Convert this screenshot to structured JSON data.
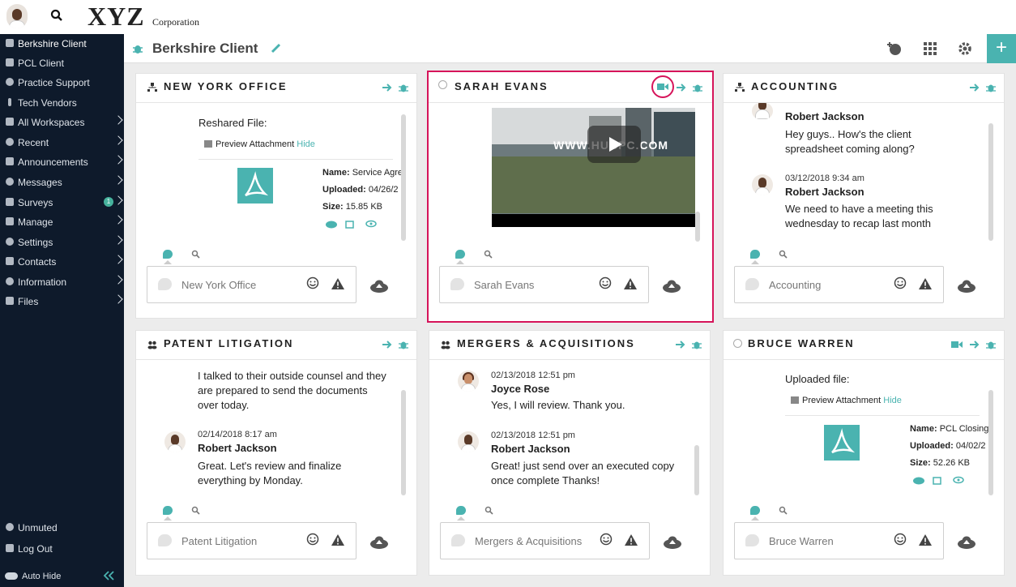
{
  "topbar": {
    "logo": "XYZ",
    "logo_sub": "Corporation"
  },
  "sidebar": {
    "items": [
      {
        "label": "Berkshire Client",
        "icon": "bug-icon"
      },
      {
        "label": "PCL Client",
        "icon": "bug-icon"
      },
      {
        "label": "Practice Support",
        "icon": "globe-icon"
      },
      {
        "label": "Tech Vendors",
        "icon": "pin-icon"
      },
      {
        "label": "All Workspaces",
        "icon": "grid-icon"
      },
      {
        "label": "Recent",
        "icon": "clock-icon"
      },
      {
        "label": "Announcements",
        "icon": "megaphone-icon"
      },
      {
        "label": "Messages",
        "icon": "chat-icon"
      },
      {
        "label": "Surveys",
        "icon": "clipboard-icon",
        "badge": "1"
      },
      {
        "label": "Manage",
        "icon": "pencil-icon"
      },
      {
        "label": "Settings",
        "icon": "gear-icon"
      },
      {
        "label": "Contacts",
        "icon": "contact-icon"
      },
      {
        "label": "Information",
        "icon": "question-icon"
      },
      {
        "label": "Files",
        "icon": "folder-icon"
      }
    ],
    "unmuted": "Unmuted",
    "logout": "Log Out",
    "autohide": "Auto Hide"
  },
  "header": {
    "title": "Berkshire Client",
    "plus": "+"
  },
  "panels": {
    "ny": {
      "title": "NEW YORK OFFICE",
      "attach_label": "Reshared File:",
      "preview": "Preview Attachment",
      "hide": "Hide",
      "name_k": "Name:",
      "name_v": "Service Agre",
      "uploaded_k": "Uploaded:",
      "uploaded_v": "04/26/2",
      "size_k": "Size:",
      "size_v": "15.85 KB",
      "placeholder": "New York Office"
    },
    "sarah": {
      "title": "SARAH EVANS",
      "video_text": "WWW.HUBPC.COM",
      "placeholder": "Sarah Evans"
    },
    "acct": {
      "title": "ACCOUNTING",
      "m1_name": "Robert Jackson",
      "m1_text": "Hey guys.. How's the client spreadsheet coming along?",
      "m2_time": "03/12/2018 9:34 am",
      "m2_name": "Robert Jackson",
      "m2_text": "We need to have a meeting this wednesday to recap last month",
      "placeholder": "Accounting"
    },
    "patent": {
      "title": "PATENT LITIGATION",
      "m1_text": "I talked to their outside counsel and they are prepared to send the documents over today.",
      "m2_time": "02/14/2018 8:17 am",
      "m2_name": "Robert Jackson",
      "m2_text": "Great.  Let's review and finalize everything by Monday.",
      "placeholder": "Patent Litigation"
    },
    "mergers": {
      "title": "MERGERS & ACQUISITIONS",
      "m1_time": "02/13/2018 12:51 pm",
      "m1_name": "Joyce Rose",
      "m1_text": "Yes, I will review.  Thank you.",
      "m2_time": "02/13/2018 12:51 pm",
      "m2_name": "Robert Jackson",
      "m2_text": "Great! just send over an executed copy once complete Thanks!",
      "placeholder": "Mergers & Acquisitions"
    },
    "bruce": {
      "title": "BRUCE WARREN",
      "attach_label": "Uploaded file:",
      "preview": "Preview Attachment",
      "hide": "Hide",
      "name_k": "Name:",
      "name_v": "PCL Closing",
      "uploaded_k": "Uploaded:",
      "uploaded_v": "04/02/2",
      "size_k": "Size:",
      "size_v": "52.26 KB",
      "placeholder": "Bruce Warren"
    }
  },
  "colors": {
    "accent": "#4ab3b0",
    "sidebar": "#0e1a2b",
    "highlight": "#d6145a"
  }
}
